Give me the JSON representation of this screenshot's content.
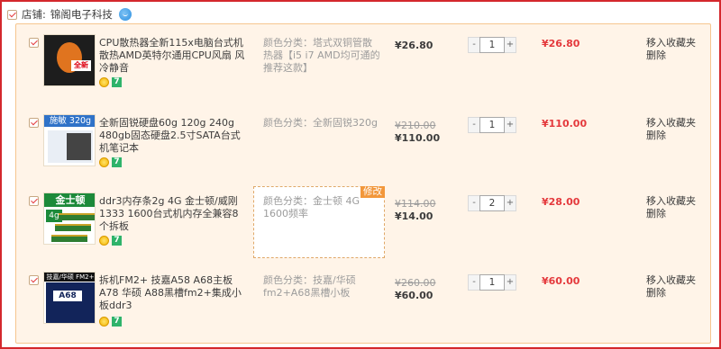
{
  "shop": {
    "label": "店铺:",
    "name": "锦阁电子科技",
    "checked": true
  },
  "items": [
    {
      "title": "CPU散热器全新115x电脑台式机散热AMD英特尔通用CPU风扇 风冷静音",
      "spec": "颜色分类：塔式双铜管散热器【i5 i7 AMD均可通的推荐这款】",
      "price_old": "",
      "price_now": "¥26.80",
      "qty": "1",
      "subtotal": "¥26.80",
      "thumb_text": "全新",
      "checked": true
    },
    {
      "title": "全新固锐硬盘60g 120g 240g 480gb固态硬盘2.5寸SATA台式机笔记本",
      "spec": "颜色分类：全新固锐320g",
      "price_old": "¥210.00",
      "price_now": "¥110.00",
      "qty": "1",
      "subtotal": "¥110.00",
      "thumb_text": "施敏 320g",
      "checked": true
    },
    {
      "title": "ddr3内存条2g 4G 金士顿/威刚1333 1600台式机内存全兼容8个拆板",
      "spec": "颜色分类：金士顿 4G 1600频率",
      "price_old": "¥114.00",
      "price_now": "¥14.00",
      "qty": "2",
      "subtotal": "¥28.00",
      "thumb_text": "金士顿",
      "thumb_text2": "4g",
      "checked": true,
      "editing": true
    },
    {
      "title": "拆机FM2+ 技嘉A58 A68主板 A78 华硕 A88黑槽fm2+集成小板ddr3",
      "spec": "颜色分类：技嘉/华硕fm2+A68黑槽小板",
      "price_old": "¥260.00",
      "price_now": "¥60.00",
      "qty": "1",
      "subtotal": "¥60.00",
      "thumb_text": "技嘉/华硕 FM2+ A68",
      "thumb_text2": "A68",
      "checked": true
    }
  ],
  "ui": {
    "minus": "-",
    "plus": "+",
    "move_fav": "移入收藏夹",
    "delete": "删除",
    "edit_tag": "修改",
    "badge_g": "7"
  },
  "colors": {
    "accent": "#e4393c",
    "frame": "#d4282d",
    "order_bg": "#fff4e8",
    "order_border": "#f6c68f"
  }
}
